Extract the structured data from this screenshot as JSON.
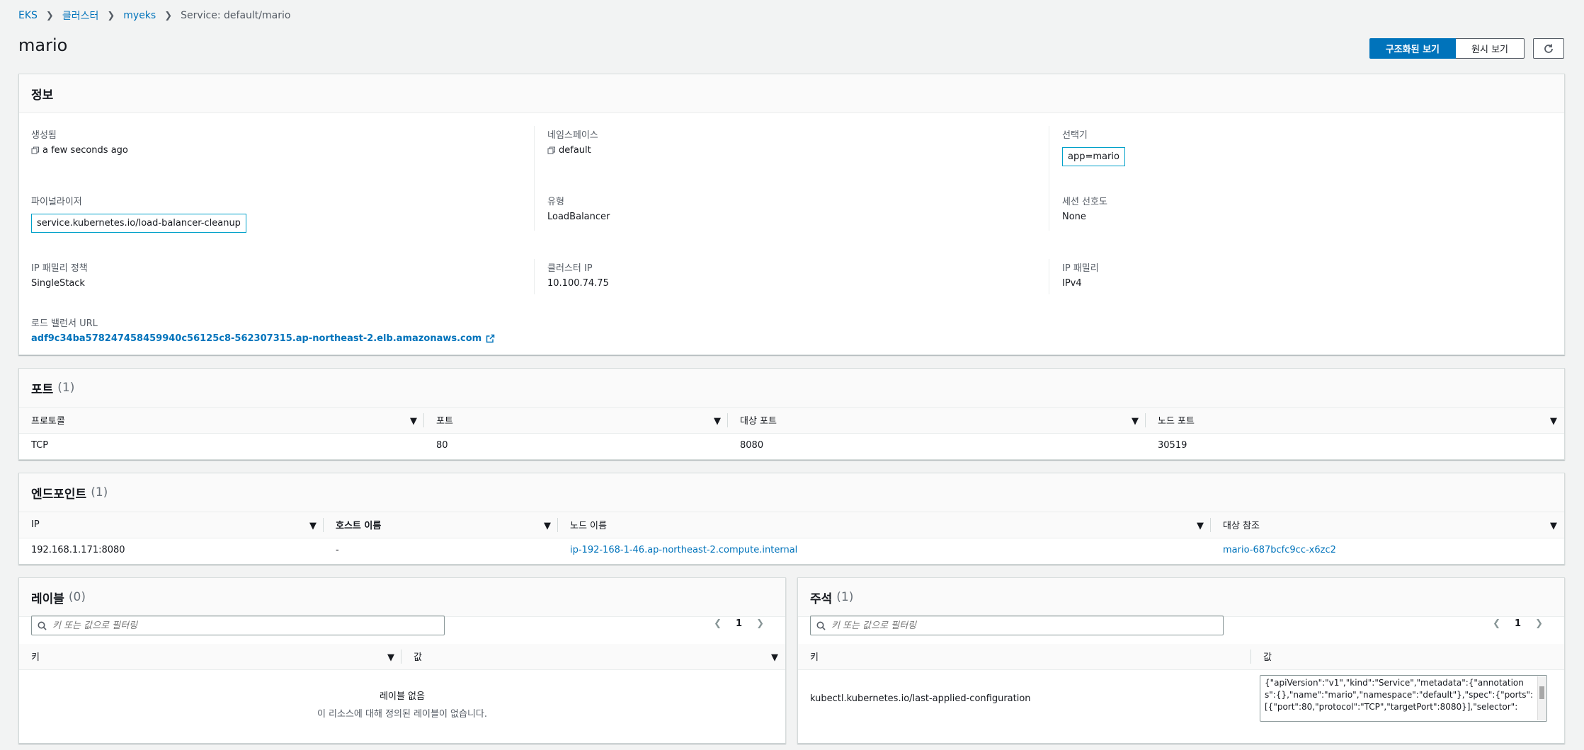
{
  "breadcrumb": {
    "eks": "EKS",
    "clusters": "클러스터",
    "cluster": "myeks",
    "current": "Service: default/mario"
  },
  "page": {
    "title": "mario"
  },
  "view": {
    "structured": "구조화된 보기",
    "raw": "원시 보기"
  },
  "info": {
    "header": "정보",
    "created_label": "생성됨",
    "created_value": "a few seconds ago",
    "namespace_label": "네임스페이스",
    "namespace_value": "default",
    "selector_label": "선택기",
    "selector_value": "app=mario",
    "finalizer_label": "파이널라이저",
    "finalizer_value": "service.kubernetes.io/load-balancer-cleanup",
    "type_label": "유형",
    "type_value": "LoadBalancer",
    "session_label": "세션 선호도",
    "session_value": "None",
    "ipfamily_policy_label": "IP 패밀리 정책",
    "ipfamily_policy_value": "SingleStack",
    "cluster_ip_label": "클러스터 IP",
    "cluster_ip_value": "10.100.74.75",
    "ipfamily_label": "IP 패밀리",
    "ipfamily_value": "IPv4",
    "lb_url_label": "로드 밸런서 URL",
    "lb_url_value": "adf9c34ba578247458459940c56125c8-562307315.ap-northeast-2.elb.amazonaws.com"
  },
  "ports": {
    "title": "포트",
    "count": "(1)",
    "columns": [
      "프로토콜",
      "포트",
      "대상 포트",
      "노드 포트"
    ],
    "rows": [
      [
        "TCP",
        "80",
        "8080",
        "30519"
      ]
    ]
  },
  "endpoints": {
    "title": "엔드포인트",
    "count": "(1)",
    "columns": [
      "IP",
      "호스트 이름",
      "노드 이름",
      "대상 참조"
    ],
    "rows": [
      [
        "192.168.1.171:8080",
        "-",
        "ip-192-168-1-46.ap-northeast-2.compute.internal",
        "mario-687bcfc9cc-x6zc2"
      ]
    ]
  },
  "labels": {
    "title": "레이블",
    "count": "(0)",
    "filter_placeholder": "키 또는 값으로 필터링",
    "page": "1",
    "columns": [
      "키",
      "값"
    ],
    "empty_title": "레이블 없음",
    "empty_desc": "이 리소스에 대해 정의된 레이블이 없습니다."
  },
  "annotations": {
    "title": "주석",
    "count": "(1)",
    "filter_placeholder": "키 또는 값으로 필터링",
    "page": "1",
    "columns": [
      "키",
      "값"
    ],
    "key": "kubectl.kubernetes.io/last-applied-configuration",
    "value": "{\"apiVersion\":\"v1\",\"kind\":\"Service\",\"metadata\":{\"annotations\":{},\"name\":\"mario\",\"namespace\":\"default\"},\"spec\":{\"ports\":[{\"port\":80,\"protocol\":\"TCP\",\"targetPort\":8080}],\"selector\":"
  },
  "colors": {
    "link": "#0073bb",
    "primary": "#0073bb",
    "tag_border": "#00a1c9"
  }
}
